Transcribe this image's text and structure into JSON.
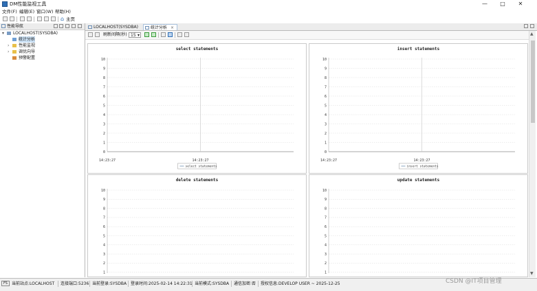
{
  "window": {
    "title": "DM性能监视工具",
    "controls": [
      "—",
      "□",
      "✕"
    ]
  },
  "menu": [
    "文件(F)",
    "编辑(E)",
    "窗口(W)",
    "帮助(H)"
  ],
  "toolbar": {
    "home_label": "主页"
  },
  "navigator": {
    "title": "性能导航",
    "root": "LOCALHOST(SYSDBA)",
    "items": [
      "统计分析",
      "性能监视",
      "调优向导",
      "预警配置"
    ],
    "selected_index": 0
  },
  "tabs": [
    {
      "label": "LOCALHOST(SYSDBA)",
      "active": false
    },
    {
      "label": "统计分析",
      "active": true
    }
  ],
  "chart_toolbar": {
    "refresh_label": "刷新间隔(秒)",
    "refresh_value": "15"
  },
  "charts": [
    {
      "title": "select statements",
      "yticks": [
        "10",
        "9",
        "8",
        "7",
        "6",
        "5",
        "4",
        "3",
        "2",
        "1",
        "0"
      ],
      "xticks": [
        "14:23:27",
        "14:23:27"
      ],
      "legend": "select statements"
    },
    {
      "title": "insert statements",
      "yticks": [
        "10",
        "9",
        "8",
        "7",
        "6",
        "5",
        "4",
        "3",
        "2",
        "1",
        "0"
      ],
      "xticks": [
        "14:23:27",
        "14:23:27"
      ],
      "legend": "insert statements"
    },
    {
      "title": "delete statements",
      "yticks": [
        "10",
        "9",
        "8",
        "7",
        "6",
        "5",
        "4",
        "3",
        "2",
        "1"
      ],
      "xticks": [],
      "legend": ""
    },
    {
      "title": "update statements",
      "yticks": [
        "10",
        "9",
        "8",
        "7",
        "6",
        "5",
        "4",
        "3",
        "2",
        "1"
      ],
      "xticks": [],
      "legend": ""
    }
  ],
  "status": {
    "icon_text": "FS",
    "site": "当前站点:LOCALHOST",
    "port": "连接端口:5236",
    "login": "当前登录:SYSDBA",
    "time": "登录时间:2025-02-14 14:22:31",
    "mode": "当前模式:SYSDBA",
    "encrypt": "通信加密:否",
    "license": "授权信息:DEVELOP USER ~ 2025-12-25"
  },
  "watermark": "CSDN @IT项目管理",
  "colors": {
    "accent": "#2f6fb5",
    "grid": "#d9d9d9",
    "baseline": "#8a8a8a"
  }
}
